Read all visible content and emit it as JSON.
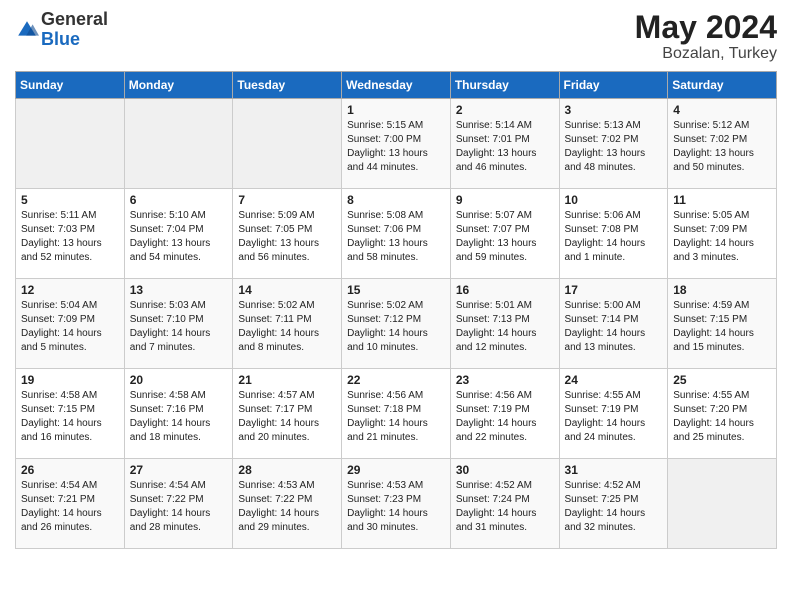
{
  "logo": {
    "general": "General",
    "blue": "Blue"
  },
  "title": {
    "month_year": "May 2024",
    "location": "Bozalan, Turkey"
  },
  "weekdays": [
    "Sunday",
    "Monday",
    "Tuesday",
    "Wednesday",
    "Thursday",
    "Friday",
    "Saturday"
  ],
  "weeks": [
    [
      {
        "day": "",
        "content": ""
      },
      {
        "day": "",
        "content": ""
      },
      {
        "day": "",
        "content": ""
      },
      {
        "day": "1",
        "content": "Sunrise: 5:15 AM\nSunset: 7:00 PM\nDaylight: 13 hours\nand 44 minutes."
      },
      {
        "day": "2",
        "content": "Sunrise: 5:14 AM\nSunset: 7:01 PM\nDaylight: 13 hours\nand 46 minutes."
      },
      {
        "day": "3",
        "content": "Sunrise: 5:13 AM\nSunset: 7:02 PM\nDaylight: 13 hours\nand 48 minutes."
      },
      {
        "day": "4",
        "content": "Sunrise: 5:12 AM\nSunset: 7:02 PM\nDaylight: 13 hours\nand 50 minutes."
      }
    ],
    [
      {
        "day": "5",
        "content": "Sunrise: 5:11 AM\nSunset: 7:03 PM\nDaylight: 13 hours\nand 52 minutes."
      },
      {
        "day": "6",
        "content": "Sunrise: 5:10 AM\nSunset: 7:04 PM\nDaylight: 13 hours\nand 54 minutes."
      },
      {
        "day": "7",
        "content": "Sunrise: 5:09 AM\nSunset: 7:05 PM\nDaylight: 13 hours\nand 56 minutes."
      },
      {
        "day": "8",
        "content": "Sunrise: 5:08 AM\nSunset: 7:06 PM\nDaylight: 13 hours\nand 58 minutes."
      },
      {
        "day": "9",
        "content": "Sunrise: 5:07 AM\nSunset: 7:07 PM\nDaylight: 13 hours\nand 59 minutes."
      },
      {
        "day": "10",
        "content": "Sunrise: 5:06 AM\nSunset: 7:08 PM\nDaylight: 14 hours\nand 1 minute."
      },
      {
        "day": "11",
        "content": "Sunrise: 5:05 AM\nSunset: 7:09 PM\nDaylight: 14 hours\nand 3 minutes."
      }
    ],
    [
      {
        "day": "12",
        "content": "Sunrise: 5:04 AM\nSunset: 7:09 PM\nDaylight: 14 hours\nand 5 minutes."
      },
      {
        "day": "13",
        "content": "Sunrise: 5:03 AM\nSunset: 7:10 PM\nDaylight: 14 hours\nand 7 minutes."
      },
      {
        "day": "14",
        "content": "Sunrise: 5:02 AM\nSunset: 7:11 PM\nDaylight: 14 hours\nand 8 minutes."
      },
      {
        "day": "15",
        "content": "Sunrise: 5:02 AM\nSunset: 7:12 PM\nDaylight: 14 hours\nand 10 minutes."
      },
      {
        "day": "16",
        "content": "Sunrise: 5:01 AM\nSunset: 7:13 PM\nDaylight: 14 hours\nand 12 minutes."
      },
      {
        "day": "17",
        "content": "Sunrise: 5:00 AM\nSunset: 7:14 PM\nDaylight: 14 hours\nand 13 minutes."
      },
      {
        "day": "18",
        "content": "Sunrise: 4:59 AM\nSunset: 7:15 PM\nDaylight: 14 hours\nand 15 minutes."
      }
    ],
    [
      {
        "day": "19",
        "content": "Sunrise: 4:58 AM\nSunset: 7:15 PM\nDaylight: 14 hours\nand 16 minutes."
      },
      {
        "day": "20",
        "content": "Sunrise: 4:58 AM\nSunset: 7:16 PM\nDaylight: 14 hours\nand 18 minutes."
      },
      {
        "day": "21",
        "content": "Sunrise: 4:57 AM\nSunset: 7:17 PM\nDaylight: 14 hours\nand 20 minutes."
      },
      {
        "day": "22",
        "content": "Sunrise: 4:56 AM\nSunset: 7:18 PM\nDaylight: 14 hours\nand 21 minutes."
      },
      {
        "day": "23",
        "content": "Sunrise: 4:56 AM\nSunset: 7:19 PM\nDaylight: 14 hours\nand 22 minutes."
      },
      {
        "day": "24",
        "content": "Sunrise: 4:55 AM\nSunset: 7:19 PM\nDaylight: 14 hours\nand 24 minutes."
      },
      {
        "day": "25",
        "content": "Sunrise: 4:55 AM\nSunset: 7:20 PM\nDaylight: 14 hours\nand 25 minutes."
      }
    ],
    [
      {
        "day": "26",
        "content": "Sunrise: 4:54 AM\nSunset: 7:21 PM\nDaylight: 14 hours\nand 26 minutes."
      },
      {
        "day": "27",
        "content": "Sunrise: 4:54 AM\nSunset: 7:22 PM\nDaylight: 14 hours\nand 28 minutes."
      },
      {
        "day": "28",
        "content": "Sunrise: 4:53 AM\nSunset: 7:22 PM\nDaylight: 14 hours\nand 29 minutes."
      },
      {
        "day": "29",
        "content": "Sunrise: 4:53 AM\nSunset: 7:23 PM\nDaylight: 14 hours\nand 30 minutes."
      },
      {
        "day": "30",
        "content": "Sunrise: 4:52 AM\nSunset: 7:24 PM\nDaylight: 14 hours\nand 31 minutes."
      },
      {
        "day": "31",
        "content": "Sunrise: 4:52 AM\nSunset: 7:25 PM\nDaylight: 14 hours\nand 32 minutes."
      },
      {
        "day": "",
        "content": ""
      }
    ]
  ]
}
